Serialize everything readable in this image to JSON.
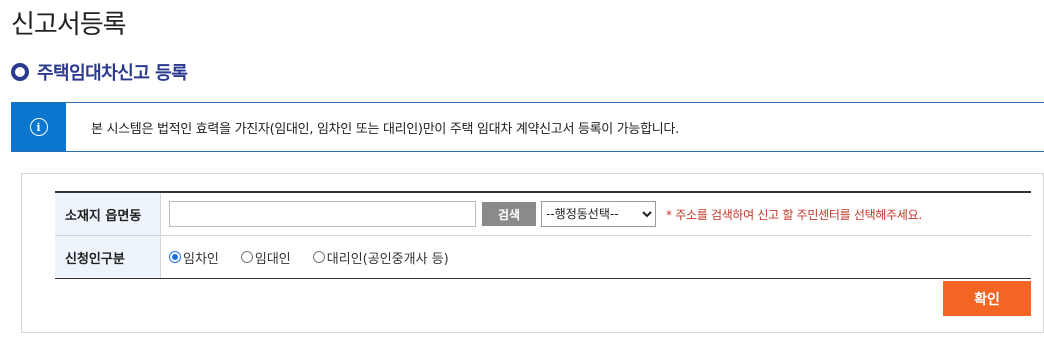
{
  "page": {
    "title": "신고서등록"
  },
  "section": {
    "title": "주택임대차신고 등록"
  },
  "notice": {
    "icon": "info-icon",
    "text": "본 시스템은 법적인 효력을 가진자(임대인, 임차인 또는 대리인)만이 주택 임대차 계약신고서 등록이 가능합니다."
  },
  "form": {
    "address_row": {
      "label": "소재지 읍면동",
      "input_value": "",
      "search_label": "검색",
      "select_value": "--행정동선택--",
      "note": "* 주소를 검색하여 신고 할 주민센터를 선택해주세요."
    },
    "applicant_row": {
      "label": "신청인구분",
      "options": [
        {
          "label": "임차인",
          "checked": true
        },
        {
          "label": "임대인",
          "checked": false
        },
        {
          "label": "대리인(공인중개사 등)",
          "checked": false
        }
      ]
    },
    "confirm_label": "확인"
  },
  "colors": {
    "accent_blue": "#2b3a8f",
    "info_blue": "#0a76d0",
    "confirm_orange": "#f26522",
    "note_red": "#c0392b"
  }
}
